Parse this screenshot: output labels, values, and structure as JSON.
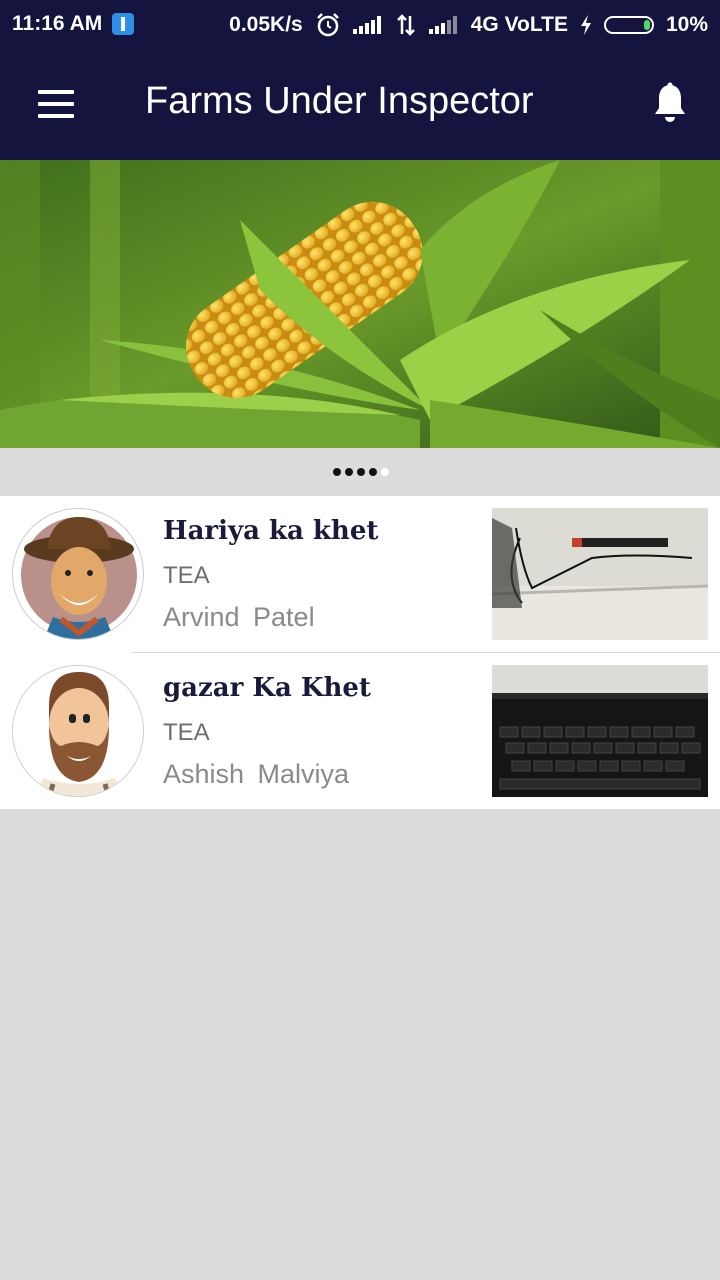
{
  "status_bar": {
    "time": "11:16 AM",
    "speed": "0.05K/s",
    "network": "4G VoLTE",
    "battery": "10%",
    "battery_level": 0.1
  },
  "app_bar": {
    "title": "Farms Under Inspector",
    "menu_icon": "hamburger-menu-icon",
    "notification_icon": "bell-icon"
  },
  "carousel": {
    "pages": 5,
    "active_index": 4
  },
  "farms": [
    {
      "name": "Hariya ka khet",
      "crop": "TEA",
      "owner": "Arvind  Patel"
    },
    {
      "name": "gazar Ka Khet",
      "crop": "TEA",
      "owner": "Ashish  Malviya"
    }
  ],
  "colors": {
    "primary": "#14143f",
    "background": "#dcdcdc"
  }
}
